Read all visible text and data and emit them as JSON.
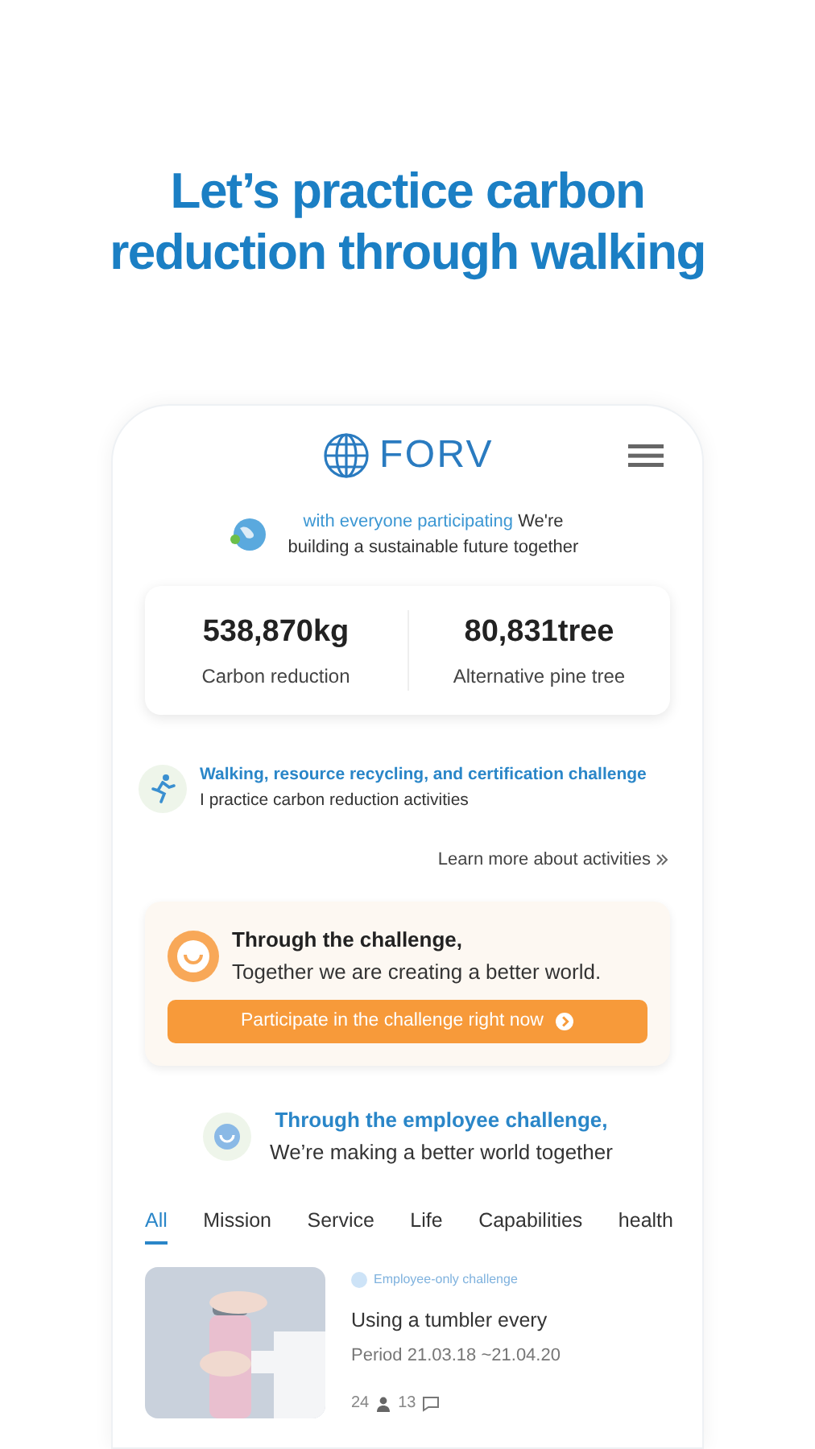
{
  "headline": [
    "Let’s practice carbon",
    "reduction through walking"
  ],
  "logo": {
    "text": "FORV"
  },
  "intro": {
    "highlight": "with everyone participating",
    "rest": "We're building a sustainable future together"
  },
  "stats": [
    {
      "value": "538,870kg",
      "label": "Carbon reduction"
    },
    {
      "value": "80,831tree",
      "label": "Alternative pine tree"
    }
  ],
  "activity": {
    "title": "Walking, resource recycling, and certification challenge",
    "subtitle": "I practice carbon reduction activities",
    "link": "Learn more about activities"
  },
  "challenge_card": {
    "title": "Through the challenge,",
    "subtitle": "Together we are creating a better world.",
    "button": "Participate in the challenge right now"
  },
  "employee": {
    "title": "Through the employee challenge,",
    "subtitle": "We’re making a better world together"
  },
  "tabs": [
    {
      "label": "All",
      "selected": true
    },
    {
      "label": "Mission",
      "selected": false
    },
    {
      "label": "Service",
      "selected": false
    },
    {
      "label": "Life",
      "selected": false
    },
    {
      "label": "Capabilities",
      "selected": false
    },
    {
      "label": "health",
      "selected": false
    }
  ],
  "items": [
    {
      "badge": "Employee-only challenge",
      "title": "Using a tumbler every",
      "period": "Period 21.03.18 ~21.04.20",
      "participants": "24",
      "comments": "13"
    }
  ]
}
